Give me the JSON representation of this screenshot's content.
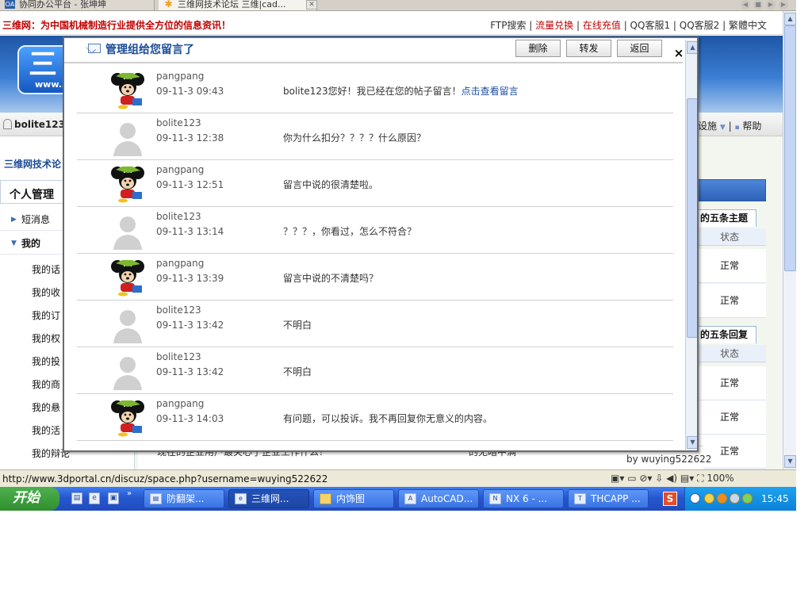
{
  "browser": {
    "tabs": [
      {
        "label": "协同办公平台 - 张坤坤",
        "icon": "app-icon"
      },
      {
        "label": "三维网技术论坛 三维|cad...",
        "icon": "star-icon",
        "active": true
      }
    ],
    "status_url": "http://www.3dportal.cn/discuz/space.php?username=wuying522622",
    "zoom": "100%"
  },
  "site": {
    "tagline": "三维网：为中国机械制造行业提供全方位的信息资讯！",
    "top_links": [
      {
        "label": "FTP搜索",
        "color": "#333333"
      },
      {
        "label": "流量兑换",
        "color": "#c00000"
      },
      {
        "label": "在线充值",
        "color": "#c00000"
      },
      {
        "label": "QQ客服1",
        "color": "#333333"
      },
      {
        "label": "QQ客服2",
        "color": "#333333"
      },
      {
        "label": "繁體中文",
        "color": "#333333"
      }
    ],
    "logo_text": "三",
    "logo_url_text": "www.3",
    "username": "bolite123",
    "menu_right": [
      "设施",
      "帮助"
    ],
    "breadcrumb": "三维网技术论",
    "left_panel": {
      "title": "个人管理",
      "items": [
        "短消息",
        "我的"
      ],
      "sub_items": [
        "我的话",
        "我的收",
        "我的订",
        "我的权",
        "我的投",
        "我的商",
        "我的悬",
        "我的活",
        "我的辩论"
      ]
    },
    "right_panel": {
      "tab1": "的五条主题",
      "tab2": "的五条回复",
      "col_label": "状态",
      "status_values": [
        "正常",
        "正常",
        "正常",
        "正常",
        "正常"
      ]
    },
    "bottom_strip": {
      "text1": "现在的企业用户最关心了企业工作什么？",
      "text2": "的无暗中满",
      "by": "by wuying522622"
    }
  },
  "modal": {
    "title": "管理组给您留言了",
    "buttons": [
      "删除",
      "转发",
      "返回"
    ],
    "close": "×",
    "messages": [
      {
        "author": "pangpang",
        "time": "09-11-3 09:43",
        "text": "bolite123您好！我已经在您的帖子留言！",
        "link": "点击查看留言",
        "avatar": "mickey"
      },
      {
        "author": "bolite123",
        "time": "09-11-3 12:38",
        "text": "你为什么扣分？？？？什么原因？",
        "link": "",
        "avatar": "default"
      },
      {
        "author": "pangpang",
        "time": "09-11-3 12:51",
        "text": "留言中说的很清楚啦。",
        "link": "",
        "avatar": "mickey"
      },
      {
        "author": "bolite123",
        "time": "09-11-3 13:14",
        "text": "？？？，你看过，怎么不符合？",
        "link": "",
        "avatar": "default"
      },
      {
        "author": "pangpang",
        "time": "09-11-3 13:39",
        "text": "留言中说的不清楚吗？",
        "link": "",
        "avatar": "mickey"
      },
      {
        "author": "bolite123",
        "time": "09-11-3 13:42",
        "text": "不明白",
        "link": "",
        "avatar": "default"
      },
      {
        "author": "bolite123",
        "time": "09-11-3 13:42",
        "text": "不明白",
        "link": "",
        "avatar": "default"
      },
      {
        "author": "pangpang",
        "time": "09-11-3 14:03",
        "text": "有问题，可以投诉。我不再回复你无意义的内容。",
        "link": "",
        "avatar": "mickey"
      }
    ]
  },
  "taskbar": {
    "start_label": "开始",
    "buttons": [
      {
        "label": "防翻架...",
        "icon": "doc-icon"
      },
      {
        "label": "三维网...",
        "icon": "ie-icon",
        "active": true
      },
      {
        "label": "内饰图",
        "icon": "folder-icon"
      },
      {
        "label": "AutoCAD...",
        "icon": "cad-icon"
      },
      {
        "label": "NX 6 - ...",
        "icon": "nx-icon"
      },
      {
        "label": "THCAPP ...",
        "icon": "thcapp-icon"
      }
    ],
    "tray_letter": "S",
    "time": "15:45"
  },
  "colors": {
    "link": "#1d4fa0",
    "red": "#c00000",
    "taskbar_blue": "#2757cf"
  }
}
